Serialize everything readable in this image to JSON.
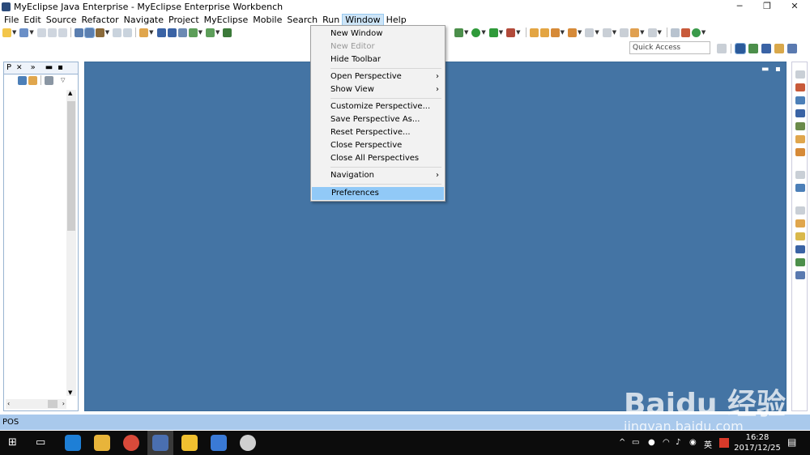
{
  "window": {
    "title": "MyEclipse Java Enterprise - MyEclipse Enterprise Workbench",
    "minimize": "─",
    "restore": "❐",
    "close": "✕"
  },
  "menubar": {
    "items": [
      "File",
      "Edit",
      "Source",
      "Refactor",
      "Navigate",
      "Project",
      "MyEclipse",
      "Mobile",
      "Search",
      "Run",
      "Window",
      "Help"
    ],
    "active_index": 10
  },
  "quick_access": {
    "placeholder": "Quick Access"
  },
  "left_view": {
    "tab_label": "P",
    "close": "✕",
    "more": "»"
  },
  "window_menu": {
    "items": [
      {
        "label": "New Window",
        "enabled": true
      },
      {
        "label": "New Editor",
        "enabled": false
      },
      {
        "label": "Hide Toolbar",
        "enabled": true
      },
      {
        "label": "Open Perspective",
        "enabled": true,
        "submenu": true
      },
      {
        "label": "Show View",
        "enabled": true,
        "submenu": true
      },
      {
        "label": "Customize Perspective...",
        "enabled": true
      },
      {
        "label": "Save Perspective As...",
        "enabled": true
      },
      {
        "label": "Reset Perspective...",
        "enabled": true
      },
      {
        "label": "Close Perspective",
        "enabled": true
      },
      {
        "label": "Close All Perspectives",
        "enabled": true
      },
      {
        "label": "Navigation",
        "enabled": true,
        "submenu": true
      },
      {
        "label": "Preferences",
        "enabled": true,
        "selected": true
      }
    ]
  },
  "statusbar": {
    "text": "POS"
  },
  "taskbar": {
    "time": "16:28",
    "date": "2017/12/25",
    "ime": "英"
  },
  "watermark": {
    "logo": "Baidu 经验",
    "url": "jingyan.baidu.com"
  },
  "colors": {
    "editor_bg": "#4474a4",
    "statusbar_bg": "#a9c9ec",
    "menu_highlight": "#91c9f7",
    "taskbar_bg": "#0c0c0c"
  }
}
